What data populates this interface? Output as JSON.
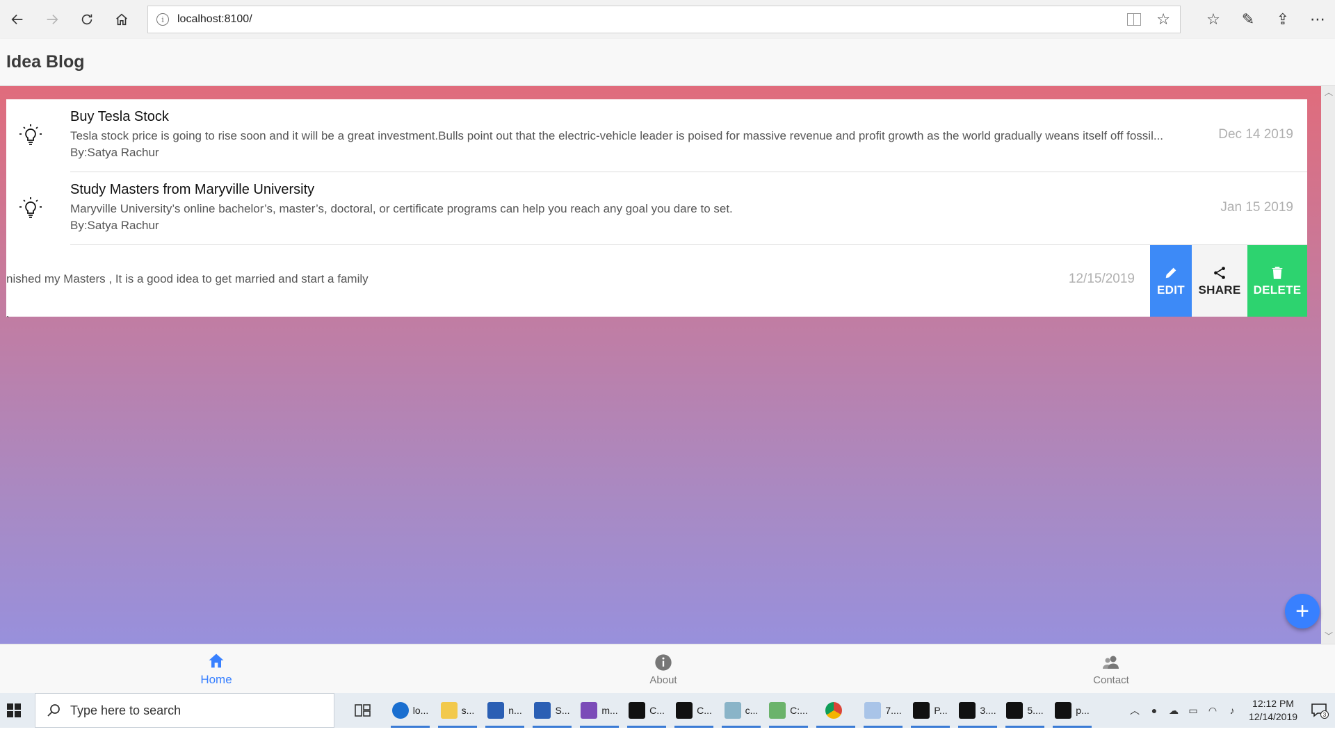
{
  "browser": {
    "url": "localhost:8100/"
  },
  "app": {
    "title": "Idea Blog"
  },
  "ideas": [
    {
      "title": "Buy Tesla Stock",
      "description": "Tesla stock price is going to rise soon and it will be a great investment.Bulls point out that the electric-vehicle leader is poised for massive revenue and profit growth as the world gradually weans itself off fossil...",
      "author": "By:Satya Rachur",
      "date": "Dec 14 2019"
    },
    {
      "title": "Study Masters from Maryville University",
      "description": "Maryville University’s online bachelor’s, master’s, doctoral, or certificate programs can help you reach any goal you dare to set.",
      "author": "By:Satya Rachur",
      "date": "Jan 15 2019"
    },
    {
      "description": "nished my Masters , It is a good idea to get married and start a family",
      "date": "12/15/2019"
    }
  ],
  "slide_options": {
    "edit": "EDIT",
    "share": "SHARE",
    "delete": "DELETE"
  },
  "stray_mark": "`",
  "fab": {
    "label": "+"
  },
  "tabs": [
    {
      "label": "Home",
      "active": true
    },
    {
      "label": "About",
      "active": false
    },
    {
      "label": "Contact",
      "active": false
    }
  ],
  "taskbar": {
    "search_placeholder": "Type here to search",
    "apps": [
      "lo...",
      "s...",
      "n...",
      "S...",
      "m...",
      "C...",
      "C...",
      "c...",
      "C:...",
      "",
      "7....",
      "P...",
      "3....",
      "5....",
      "p..."
    ],
    "time": "12:12 PM",
    "date": "12/14/2019",
    "notifications": "3"
  },
  "colors": {
    "gradient_top": "#e06c7c",
    "gradient_bottom": "#9890dc",
    "primary": "#3880ff",
    "edit": "#3d8af7",
    "delete": "#2dd36f"
  }
}
